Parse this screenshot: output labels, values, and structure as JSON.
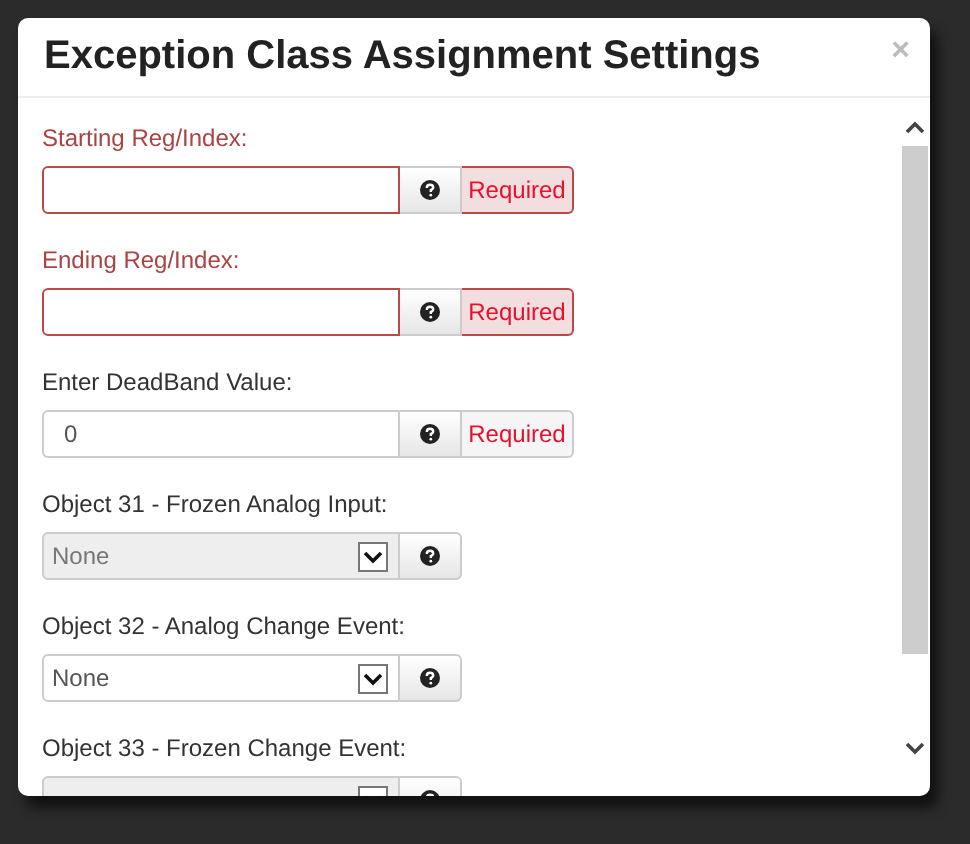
{
  "dialog": {
    "title": "Exception Class Assignment Settings",
    "close": "×"
  },
  "fields": [
    {
      "kind": "input",
      "label": "Starting Reg/Index:",
      "invalid": true,
      "required": "Required"
    },
    {
      "kind": "input",
      "label": "Ending Reg/Index:",
      "invalid": true,
      "required": "Required"
    },
    {
      "kind": "input",
      "label": "Enter DeadBand Value:",
      "value": "0",
      "invalid": false,
      "required": "Required"
    },
    {
      "kind": "select",
      "label": "Object 31 - Frozen Analog Input:",
      "value": "None",
      "disabled": true
    },
    {
      "kind": "select",
      "label": "Object 32 - Analog Change Event:",
      "value": "None",
      "disabled": false
    },
    {
      "kind": "select",
      "label": "Object 33 - Frozen Change Event:",
      "disabled": true
    }
  ]
}
